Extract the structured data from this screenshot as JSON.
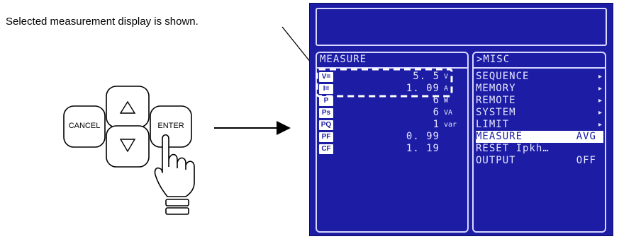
{
  "caption": "Selected measurement display is shown.",
  "keypad": {
    "cancel_label": "CANCEL",
    "enter_label": "ENTER",
    "up_icon": "triangle-up-icon",
    "down_icon": "triangle-down-icon",
    "hand_icon": "pointing-hand-icon"
  },
  "screen": {
    "background_color": "#1c1ca4",
    "measure_panel": {
      "title": "MEASURE",
      "rows": [
        {
          "icon": "V=",
          "value": "5. 5",
          "unit": "V"
        },
        {
          "icon": "I=",
          "value": "1. 09",
          "unit": "A"
        },
        {
          "icon": "P",
          "value": "6",
          "unit": "W"
        },
        {
          "icon": "Ps",
          "value": "6",
          "unit": "VA"
        },
        {
          "icon": "PQ",
          "value": "1",
          "unit": "var"
        },
        {
          "icon": "PF",
          "value": "0. 99",
          "unit": ""
        },
        {
          "icon": "CF",
          "value": "1. 19",
          "unit": ""
        }
      ]
    },
    "menu_panel": {
      "title": ">MISC",
      "items": [
        {
          "label": "SEQUENCE",
          "arrow": "▸",
          "value": ""
        },
        {
          "label": "MEMORY",
          "arrow": "▸",
          "value": ""
        },
        {
          "label": "REMOTE",
          "arrow": "▸",
          "value": ""
        },
        {
          "label": "SYSTEM",
          "arrow": "▸",
          "value": ""
        },
        {
          "label": "LIMIT",
          "arrow": "▸",
          "value": ""
        },
        {
          "label": "MEASURE",
          "arrow": "",
          "value": "AVG"
        },
        {
          "label": "RESET Ipkh…",
          "arrow": "",
          "value": ""
        },
        {
          "label": "OUTPUT",
          "arrow": "",
          "value": "OFF"
        }
      ],
      "highlighted_index": 5
    }
  }
}
